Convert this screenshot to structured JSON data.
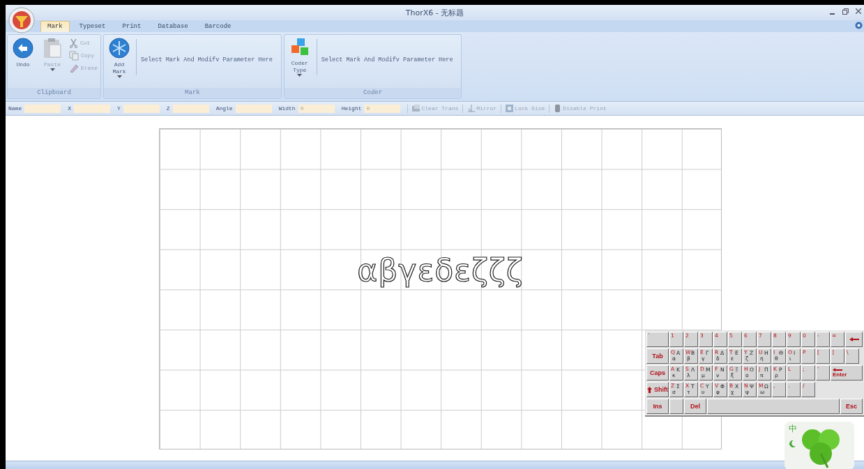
{
  "window": {
    "title": "ThorX6 - 无标题"
  },
  "tabs": [
    {
      "label": "Mark",
      "selected": true
    },
    {
      "label": "Typeset",
      "selected": false
    },
    {
      "label": "Print",
      "selected": false
    },
    {
      "label": "Database",
      "selected": false
    },
    {
      "label": "Barcode",
      "selected": false
    }
  ],
  "ribbon": [
    {
      "title": "Clipboard",
      "items": [
        {
          "kind": "large",
          "label": "Undo",
          "disabled": false
        },
        {
          "kind": "large",
          "label": "Paste",
          "disabled": true,
          "dropdown": true
        },
        {
          "kind": "small",
          "label": "Cut",
          "disabled": true
        },
        {
          "kind": "small",
          "label": "Copy",
          "disabled": true
        },
        {
          "kind": "small",
          "label": "Erase",
          "disabled": true
        }
      ]
    },
    {
      "title": "Mark",
      "items": [
        {
          "kind": "large",
          "label": "Add Mark",
          "disabled": false,
          "dropdown": true
        },
        {
          "kind": "hint",
          "label": "Select Mark And Modifv Parameter Here"
        }
      ]
    },
    {
      "title": "Coder",
      "items": [
        {
          "kind": "large",
          "label": "Coder Type",
          "disabled": false,
          "dropdown": true
        },
        {
          "kind": "hint",
          "label": "Select Mark And Modifv Parameter Here"
        }
      ]
    }
  ],
  "properties": {
    "fields": [
      {
        "label": "Name"
      },
      {
        "label": "X"
      },
      {
        "label": "Y"
      },
      {
        "label": "Z"
      },
      {
        "label": "Angle"
      },
      {
        "label": "Width",
        "value": "0"
      },
      {
        "label": "Height",
        "value": "0"
      }
    ],
    "buttons": [
      {
        "label": "Clear Trans",
        "disabled": true
      },
      {
        "label": "Mirror",
        "disabled": true
      },
      {
        "label": "Lock Size",
        "disabled": true
      },
      {
        "label": "Disable Print",
        "disabled": true
      }
    ]
  },
  "canvas": {
    "text": "αβγεδεζζζ"
  },
  "keyboard": {
    "rows": [
      [
        {
          "kind": "key",
          "latin": "`"
        },
        {
          "kind": "key",
          "latin": "1"
        },
        {
          "kind": "key",
          "latin": "2"
        },
        {
          "kind": "key",
          "latin": "3"
        },
        {
          "kind": "key",
          "latin": "4"
        },
        {
          "kind": "key",
          "latin": "5"
        },
        {
          "kind": "key",
          "latin": "6"
        },
        {
          "kind": "key",
          "latin": "7"
        },
        {
          "kind": "key",
          "latin": "8"
        },
        {
          "kind": "key",
          "latin": "9"
        },
        {
          "kind": "key",
          "latin": "0"
        },
        {
          "kind": "key",
          "latin": "-"
        },
        {
          "kind": "key",
          "latin": "="
        },
        {
          "kind": "backspace"
        }
      ],
      [
        {
          "kind": "mod",
          "label": "Tab"
        },
        {
          "kind": "key",
          "latin": "Q",
          "upper": "Α",
          "lower": "α"
        },
        {
          "kind": "key",
          "latin": "W",
          "upper": "Β",
          "lower": "β"
        },
        {
          "kind": "key",
          "latin": "E",
          "upper": "Γ",
          "lower": "γ"
        },
        {
          "kind": "key",
          "latin": "R",
          "upper": "Δ",
          "lower": "δ"
        },
        {
          "kind": "key",
          "latin": "T",
          "upper": "Ε",
          "lower": "ε"
        },
        {
          "kind": "key",
          "latin": "Y",
          "upper": "Ζ",
          "lower": "ζ"
        },
        {
          "kind": "key",
          "latin": "U",
          "upper": "Η",
          "lower": "η"
        },
        {
          "kind": "key",
          "latin": "I",
          "upper": "Θ",
          "lower": "θ"
        },
        {
          "kind": "key",
          "latin": "O",
          "upper": "Ι",
          "lower": "ι"
        },
        {
          "kind": "key",
          "latin": "P"
        },
        {
          "kind": "key",
          "latin": "["
        },
        {
          "kind": "key",
          "latin": "]"
        },
        {
          "kind": "key",
          "latin": "\\"
        }
      ],
      [
        {
          "kind": "mod",
          "label": "Caps"
        },
        {
          "kind": "key",
          "latin": "A",
          "upper": "Κ",
          "lower": "κ"
        },
        {
          "kind": "key",
          "latin": "S",
          "upper": "Λ",
          "lower": "λ"
        },
        {
          "kind": "key",
          "latin": "D",
          "upper": "Μ",
          "lower": "μ"
        },
        {
          "kind": "key",
          "latin": "F",
          "upper": "Ν",
          "lower": "ν"
        },
        {
          "kind": "key",
          "latin": "G",
          "upper": "Ξ",
          "lower": "ξ"
        },
        {
          "kind": "key",
          "latin": "H",
          "upper": "Ο",
          "lower": "ο"
        },
        {
          "kind": "key",
          "latin": "J",
          "upper": "Π",
          "lower": "π"
        },
        {
          "kind": "key",
          "latin": "K",
          "upper": "Ρ",
          "lower": "ρ"
        },
        {
          "kind": "key",
          "latin": "L"
        },
        {
          "kind": "key",
          "latin": ";"
        },
        {
          "kind": "key",
          "latin": "'"
        },
        {
          "kind": "enter",
          "label": "Enter"
        }
      ],
      [
        {
          "kind": "shift",
          "label": "Shift"
        },
        {
          "kind": "key",
          "latin": "Z",
          "upper": "Σ",
          "lower": "σ"
        },
        {
          "kind": "key",
          "latin": "X",
          "upper": "Τ",
          "lower": "τ"
        },
        {
          "kind": "key",
          "latin": "C",
          "upper": "Υ",
          "lower": "υ"
        },
        {
          "kind": "key",
          "latin": "V",
          "upper": "Φ",
          "lower": "φ"
        },
        {
          "kind": "key",
          "latin": "B",
          "upper": "Χ",
          "lower": "χ"
        },
        {
          "kind": "key",
          "latin": "N",
          "upper": "Ψ",
          "lower": "ψ"
        },
        {
          "kind": "key",
          "latin": "M",
          "upper": "Ω",
          "lower": "ω"
        },
        {
          "kind": "key",
          "latin": ","
        },
        {
          "kind": "key",
          "latin": "."
        },
        {
          "kind": "key",
          "latin": "/"
        }
      ]
    ],
    "bottom_keys": [
      {
        "kind": "mod",
        "label": "Ins"
      },
      {
        "kind": "blank"
      },
      {
        "kind": "mod",
        "label": "Del"
      },
      {
        "kind": "space"
      },
      {
        "kind": "mod",
        "label": "Esc"
      }
    ]
  },
  "ime": {
    "label": "中"
  }
}
